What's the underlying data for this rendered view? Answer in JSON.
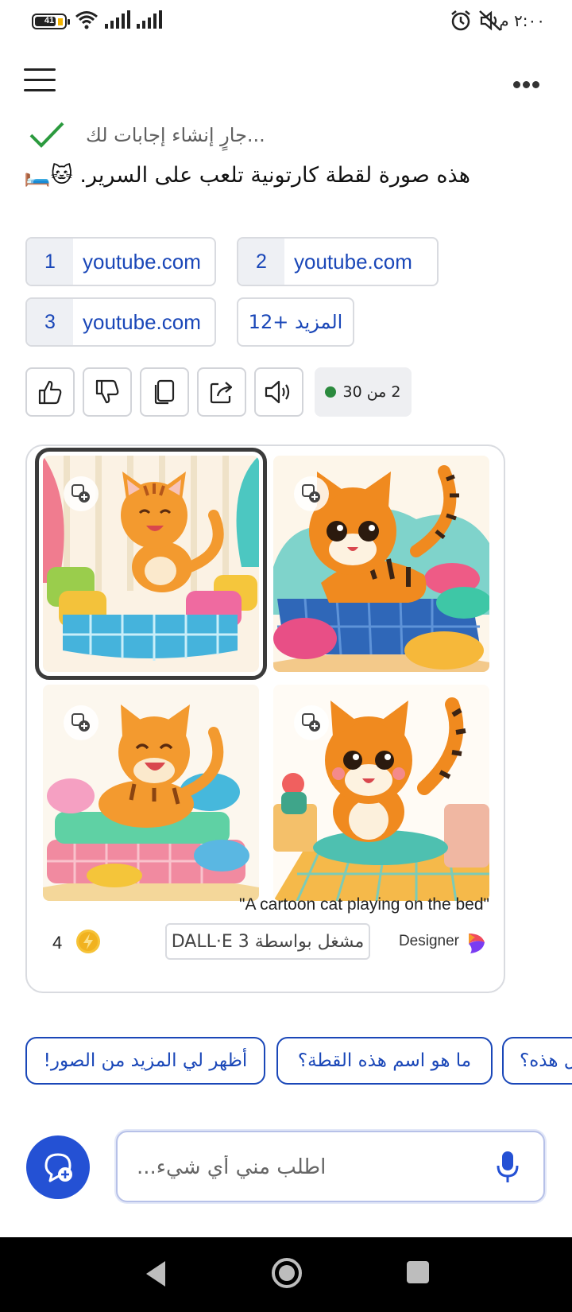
{
  "status_bar": {
    "battery_level": "41",
    "time": "٢:٠٠ م",
    "icons": [
      "battery-icon",
      "wifi-icon",
      "signal-icon",
      "signal-icon",
      "alarm-icon",
      "mute-icon"
    ]
  },
  "header": {
    "menu_icon": "hamburger-menu-icon",
    "more_icon": "more-options-icon"
  },
  "response": {
    "status_text": "...جارٍ إنشاء إجابات لك",
    "answer_text": "هذه صورة لقطة كارتونية تلعب على السرير.",
    "answer_emoji": "🐱🛏️"
  },
  "sources": [
    {
      "num": "1",
      "label": "youtube.com"
    },
    {
      "num": "2",
      "label": "youtube.com"
    },
    {
      "num": "3",
      "label": "youtube.com"
    }
  ],
  "sources_more": "المزيد +12",
  "actions": {
    "icons": [
      "thumbs-up-icon",
      "thumbs-down-icon",
      "copy-icon",
      "share-icon",
      "speaker-icon"
    ],
    "count_text": "2 من 30",
    "count_color": "#2b8a3e"
  },
  "image_card": {
    "caption": "\"A cartoon cat playing on the bed\"",
    "coin_count": "4",
    "dalle_badge": "مشغل بواسطة DALL·E 3",
    "designer_label": "Designer",
    "selected_index": 0
  },
  "suggestions": [
    "أظهر لي المزيد من الصور!",
    "ما هو اسم هذه القطة؟",
    "هل هذه؟"
  ],
  "input": {
    "placeholder": "اطلب مني أي شيء..."
  },
  "colors": {
    "accent": "#1a47b8",
    "button_blue": "#2451d4",
    "check_green": "#2b9a3e"
  }
}
